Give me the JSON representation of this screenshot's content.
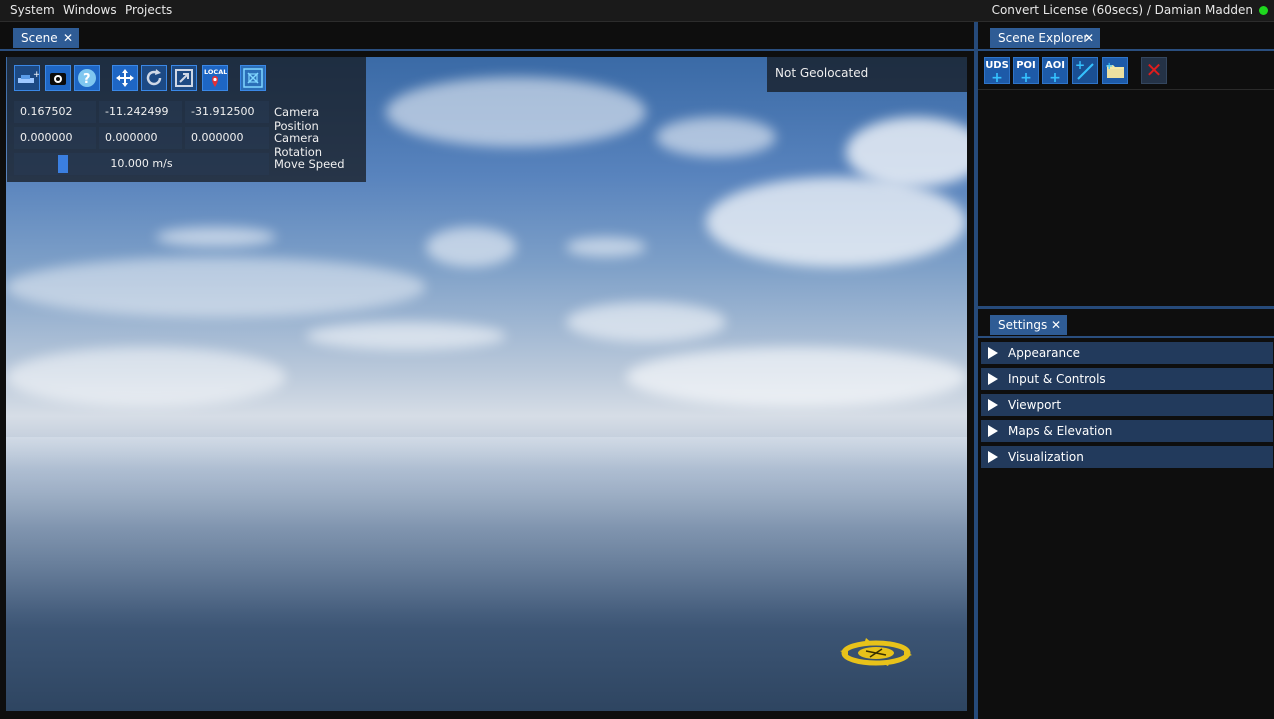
{
  "menubar": {
    "items": [
      "System",
      "Windows",
      "Projects"
    ],
    "license": "Convert License (60secs) / Damian Madden",
    "status_color": "#1ed81e"
  },
  "scene": {
    "tab_label": "Scene",
    "close_glyph": "✕",
    "toolbar": {
      "icons": [
        "add-model-icon",
        "camera-settings-icon",
        "help-icon",
        "translate-gizmo-icon",
        "rotate-gizmo-icon",
        "scale-gizmo-icon",
        "local-space-icon",
        "fullscreen-icon"
      ],
      "local_label": "LOCAL"
    },
    "camera_position": {
      "x": "0.167502",
      "y": "-11.242499",
      "z": "-31.912500",
      "label": "Camera Position"
    },
    "camera_rotation": {
      "x": "0.000000",
      "y": "0.000000",
      "z": "0.000000",
      "label": "Camera Rotation"
    },
    "move_speed": {
      "value": "10.000 m/s",
      "label": "Move Speed",
      "fraction": 0.2
    },
    "geolocation": "Not Geolocated"
  },
  "scene_explorer": {
    "tab_label": "Scene Explorer",
    "close_glyph": "✕",
    "buttons": [
      {
        "name": "add-uds-button",
        "text": "UDS",
        "icon": "plus-icon"
      },
      {
        "name": "add-poi-button",
        "text": "POI",
        "icon": "plus-icon"
      },
      {
        "name": "add-aoi-button",
        "text": "AOI",
        "icon": "plus-icon"
      },
      {
        "name": "add-line-button",
        "icon": "add-line-icon"
      },
      {
        "name": "add-folder-button",
        "icon": "folder-icon"
      },
      {
        "name": "delete-button",
        "icon": "delete-x-icon",
        "text": "✕"
      }
    ]
  },
  "settings": {
    "tab_label": "Settings",
    "close_glyph": "✕",
    "sections": [
      "Appearance",
      "Input & Controls",
      "Viewport",
      "Maps & Elevation",
      "Visualization"
    ]
  },
  "colors": {
    "accent": "#2f5c95",
    "splitter": "#264a7a",
    "section_bg": "#223a5c",
    "gizmo": "#e8c21a"
  }
}
